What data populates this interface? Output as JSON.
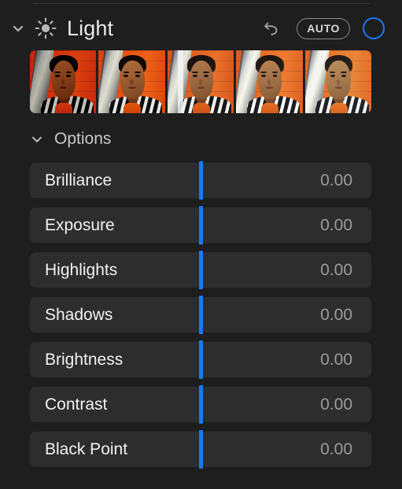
{
  "panel": {
    "title": "Light",
    "icon": "sun-icon",
    "expanded": true,
    "disclosure_icon": "chevron-down-icon",
    "accent_color": "#1a79f0",
    "background_color": "#1e1e1e",
    "row_color": "#2d2d2d"
  },
  "header_controls": {
    "revert_icon": "revert-arrow-icon",
    "auto_label": "AUTO",
    "toggle_icon": "circle-toggle-icon",
    "toggle_on": true
  },
  "filmstrip": {
    "selected_index": 2,
    "thumbnails": [
      {
        "label": "preview-1",
        "brightness": 0.74,
        "contrast": 1.22,
        "saturate": 1.28,
        "hue": -6
      },
      {
        "label": "preview-2",
        "brightness": 0.92,
        "contrast": 1.08,
        "saturate": 1.12,
        "hue": -2
      },
      {
        "label": "preview-3",
        "brightness": 1.0,
        "contrast": 1.0,
        "saturate": 1.0,
        "hue": 0
      },
      {
        "label": "preview-4",
        "brightness": 1.08,
        "contrast": 0.96,
        "saturate": 0.96,
        "hue": 2
      },
      {
        "label": "preview-5",
        "brightness": 1.16,
        "contrast": 0.92,
        "saturate": 0.92,
        "hue": 4
      }
    ]
  },
  "options": {
    "label": "Options",
    "expanded": true,
    "chevron_icon": "chevron-down-icon"
  },
  "sliders": [
    {
      "name": "Brilliance",
      "value": "0.00",
      "handle_pct": 50
    },
    {
      "name": "Exposure",
      "value": "0.00",
      "handle_pct": 50
    },
    {
      "name": "Highlights",
      "value": "0.00",
      "handle_pct": 50
    },
    {
      "name": "Shadows",
      "value": "0.00",
      "handle_pct": 50
    },
    {
      "name": "Brightness",
      "value": "0.00",
      "handle_pct": 50
    },
    {
      "name": "Contrast",
      "value": "0.00",
      "handle_pct": 50
    },
    {
      "name": "Black Point",
      "value": "0.00",
      "handle_pct": 50
    }
  ]
}
